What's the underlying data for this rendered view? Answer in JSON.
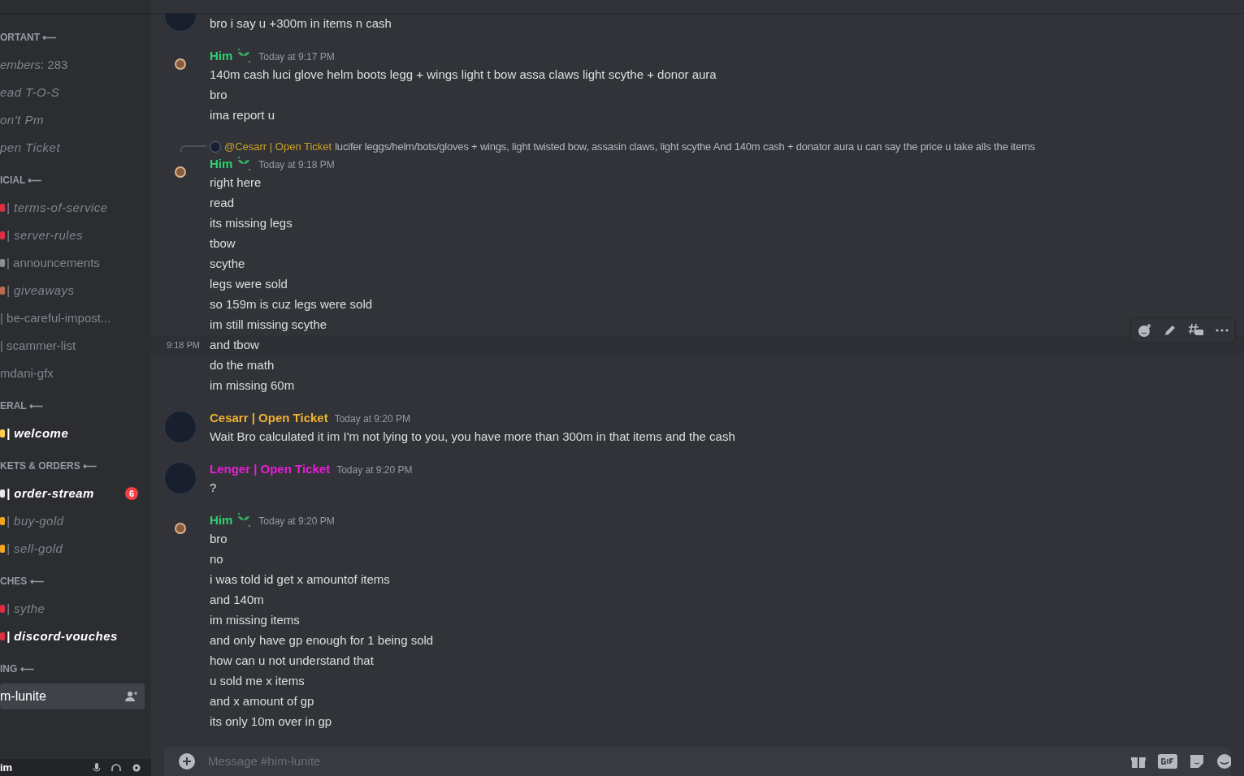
{
  "sidebar": {
    "sections": [
      {
        "title": "ORTANT ⟵",
        "channels": [
          {
            "name": "*embers*: 283",
            "kind": "plain",
            "italic": false,
            "unread": false,
            "selected": false
          },
          {
            "name": "ead T-O-S",
            "kind": "plain",
            "italic": true,
            "unread": false,
            "selected": false
          },
          {
            "name": "on't Pm",
            "kind": "plain",
            "italic": true,
            "unread": false,
            "selected": false
          },
          {
            "name": "pen Ticket",
            "kind": "plain",
            "italic": true,
            "unread": false,
            "selected": false
          }
        ]
      },
      {
        "title": "ICIAL ⟵",
        "channels": [
          {
            "name": "| terms-of-service",
            "kind": "bell",
            "italic": true,
            "unread": false,
            "selected": false
          },
          {
            "name": "| server-rules",
            "kind": "bell",
            "italic": true,
            "unread": false,
            "selected": false
          },
          {
            "name": "| announcements",
            "kind": "star",
            "italic": false,
            "unread": false,
            "selected": false
          },
          {
            "name": "| giveaways",
            "kind": "gift",
            "italic": true,
            "unread": false,
            "selected": false
          },
          {
            "name": "| be-careful-impost...",
            "kind": "plain",
            "italic": false,
            "unread": false,
            "selected": false
          },
          {
            "name": "| scammer-list",
            "kind": "plain",
            "italic": false,
            "unread": false,
            "selected": false
          },
          {
            "name": "mdani-gfx",
            "kind": "plain",
            "italic": false,
            "unread": false,
            "selected": false
          }
        ]
      },
      {
        "title": "ERAL ⟵",
        "channels": [
          {
            "name": "| welcome",
            "kind": "hand",
            "italic": true,
            "unread": true,
            "selected": false
          }
        ]
      },
      {
        "title": "KETS & ORDERS ⟵",
        "channels": [
          {
            "name": "| order-stream",
            "kind": "note",
            "italic": true,
            "unread": true,
            "selected": false,
            "badge": "6"
          },
          {
            "name": "| buy-gold",
            "kind": "coin",
            "italic": true,
            "unread": false,
            "selected": false
          },
          {
            "name": "| sell-gold",
            "kind": "coin",
            "italic": true,
            "unread": false,
            "selected": false
          }
        ]
      },
      {
        "title": "CHES ⟵",
        "channels": [
          {
            "name": "| sythe",
            "kind": "pin",
            "italic": true,
            "unread": false,
            "selected": false
          },
          {
            "name": "| discord-vouches",
            "kind": "pin",
            "italic": true,
            "unread": true,
            "selected": false
          }
        ]
      },
      {
        "title": "ING ⟵",
        "channels": [
          {
            "name": "m-lunite",
            "kind": "plain",
            "italic": false,
            "unread": true,
            "selected": true
          }
        ]
      }
    ],
    "user": {
      "name": "im"
    }
  },
  "chat": {
    "groups": [
      {
        "kind": "continued",
        "lines": [
          {
            "text": "bro i say u +300m in items n cash",
            "hovered": false
          }
        ]
      },
      {
        "kind": "badged",
        "author": "Him",
        "color": "#2dd36f",
        "time": "Today at 9:17 PM",
        "lines": [
          {
            "text": "140m cash luci glove helm boots legg + wings light t bow assa claws light scythe + donor aura",
            "hovered": false
          },
          {
            "text": "bro",
            "hovered": false
          },
          {
            "text": "ima report u",
            "hovered": false
          }
        ]
      },
      {
        "kind": "badged",
        "author": "Him",
        "color": "#2dd36f",
        "time": "Today at 9:18 PM",
        "reply": {
          "mention": "@Cesarr | Open Ticket",
          "text": "lucifer leggs/helm/bots/gloves + wings, light twisted bow, assasin claws, light scythe And 140m cash + donator aura u can say the price u take alls the items"
        },
        "lines": [
          {
            "text": "right here",
            "hovered": false
          },
          {
            "text": "read",
            "hovered": false
          },
          {
            "text": "its missing legs",
            "hovered": false
          },
          {
            "text": "tbow",
            "hovered": false
          },
          {
            "text": "scythe",
            "hovered": false
          },
          {
            "text": "legs were sold",
            "hovered": false
          },
          {
            "text": "so 159m is cuz legs were sold",
            "hovered": false
          },
          {
            "text": "im still missing scythe",
            "hovered": false
          },
          {
            "text": "and tbow",
            "hovered": true,
            "hover_time": "9:18 PM"
          },
          {
            "text": "do the math",
            "hovered": false
          },
          {
            "text": "im missing 60m",
            "hovered": false
          }
        ]
      },
      {
        "kind": "plain",
        "author": "Cesarr | Open Ticket",
        "color": "#f0b232",
        "time": "Today at 9:20 PM",
        "lines": [
          {
            "text": "Wait Bro calculated it im I'm not lying to you, you have more than 300m in that items and the cash",
            "hovered": false
          }
        ]
      },
      {
        "kind": "plain",
        "author": "Lenger | Open Ticket",
        "color": "#e91ed8",
        "time": "Today at 9:20 PM",
        "lines": [
          {
            "text": "?",
            "hovered": false
          }
        ]
      },
      {
        "kind": "badged",
        "author": "Him",
        "color": "#2dd36f",
        "time": "Today at 9:20 PM",
        "lines": [
          {
            "text": "bro",
            "hovered": false
          },
          {
            "text": "no",
            "hovered": false
          },
          {
            "text": "i was told id get x amountof items",
            "hovered": false
          },
          {
            "text": "and 140m",
            "hovered": false
          },
          {
            "text": "im missing items",
            "hovered": false
          },
          {
            "text": "and only have gp enough for 1 being sold",
            "hovered": false
          },
          {
            "text": "how can u not understand that",
            "hovered": false
          },
          {
            "text": "u sold me x items",
            "hovered": false
          },
          {
            "text": "and x amount of gp",
            "hovered": false
          },
          {
            "text": "its only 10m over in gp",
            "hovered": false
          }
        ]
      }
    ],
    "composer": {
      "placeholder": "Message #him-lunite"
    }
  }
}
